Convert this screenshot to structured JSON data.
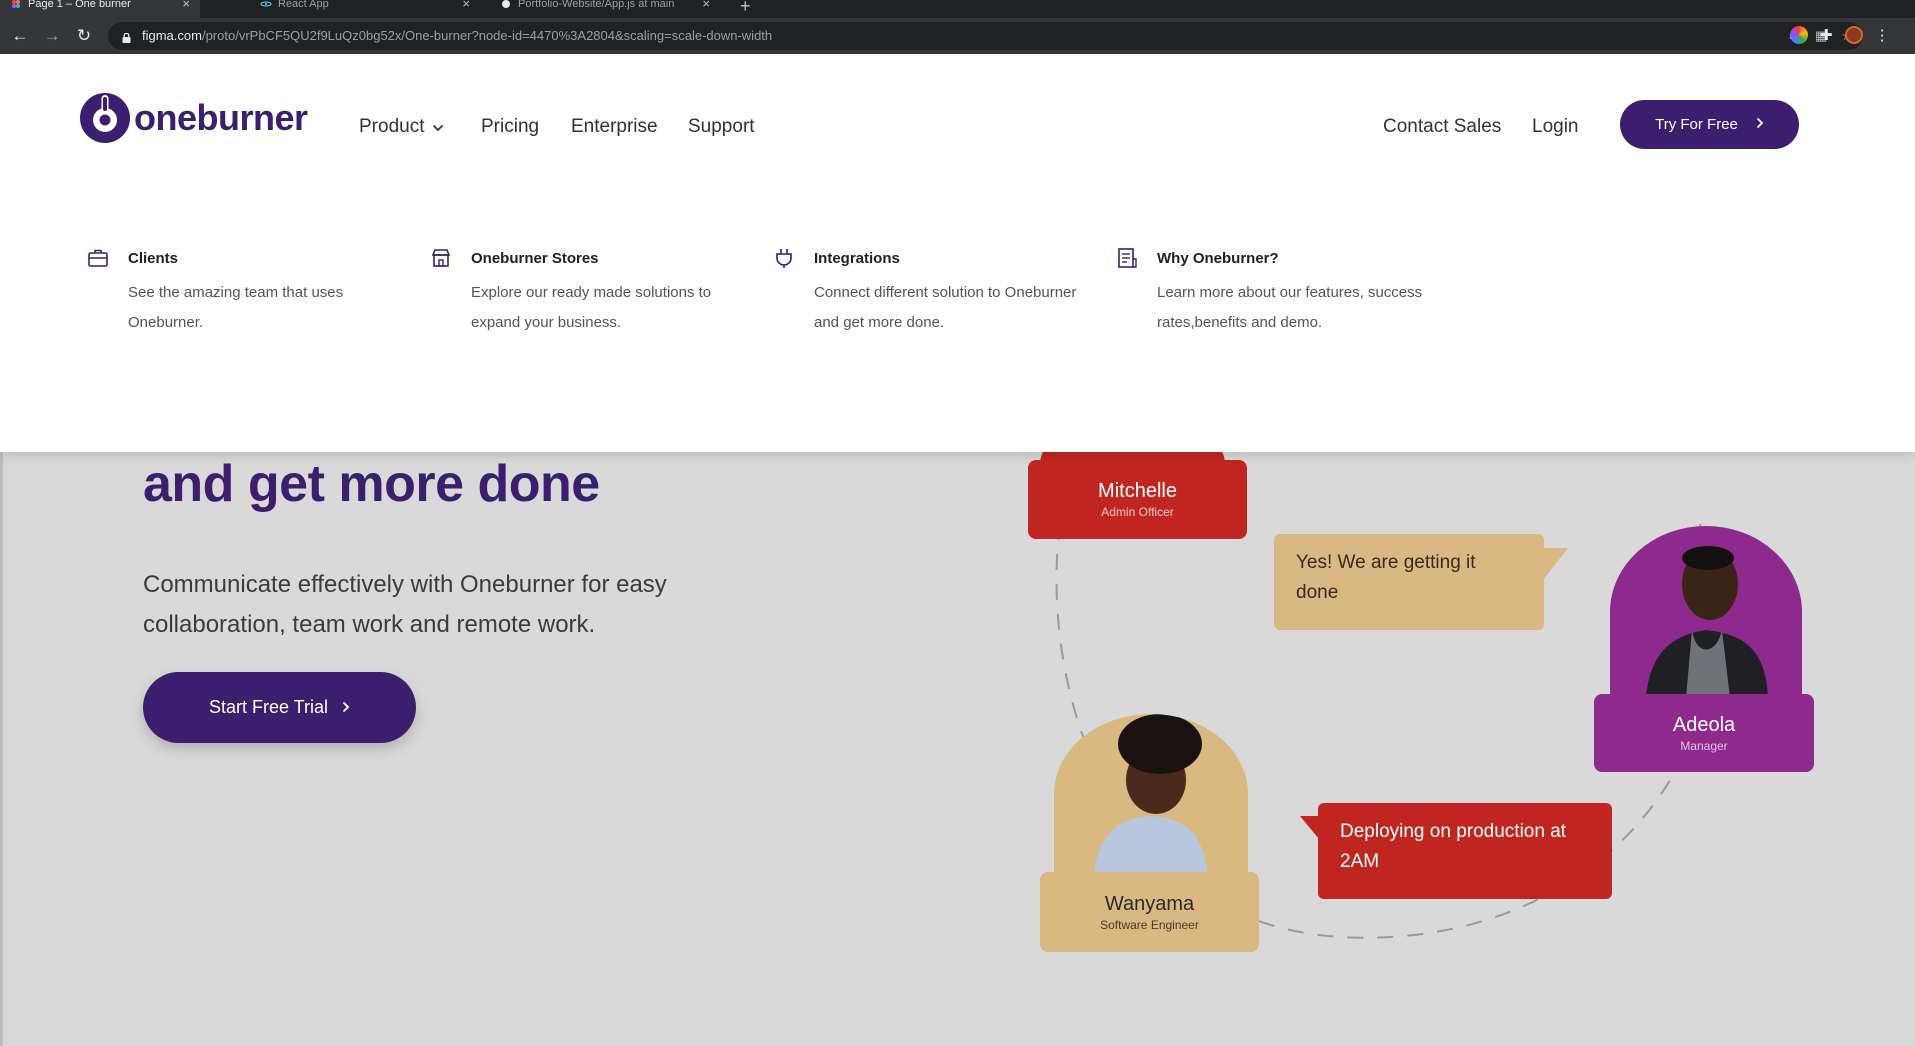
{
  "browser": {
    "tabs": [
      {
        "title": "Page 1 – One burner",
        "icon": "figma-icon",
        "active": true
      },
      {
        "title": "React App",
        "icon": "react-icon",
        "active": false
      },
      {
        "title": "Portfolio-Website/App.js at main",
        "icon": "github-icon",
        "active": false
      }
    ],
    "url_host": "figma.com",
    "url_path": "/proto/vrPbCF5QU2f9LuQz0bg52x/One-burner?node-id=4470%3A2804&scaling=scale-down-width"
  },
  "header": {
    "logo_text": "oneburner",
    "nav": {
      "product": "Product",
      "pricing": "Pricing",
      "enterprise": "Enterprise",
      "support": "Support"
    },
    "contact_sales": "Contact Sales",
    "login": "Login",
    "try_free": "Try For Free"
  },
  "product_menu": {
    "items": [
      {
        "icon": "briefcase-icon",
        "title": "Clients",
        "description": "See the amazing team that uses Oneburner."
      },
      {
        "icon": "store-icon",
        "title": "Oneburner Stores",
        "description": "Explore our ready made solutions to expand your business."
      },
      {
        "icon": "plug-icon",
        "title": "Integrations",
        "description": "Connect different solution to Oneburner and get more done."
      },
      {
        "icon": "document-icon",
        "title": "Why Oneburner?",
        "description": "Learn more about our features, success rates,benefits and demo."
      }
    ]
  },
  "hero": {
    "title_line2": "and get more done",
    "subtitle": "Communicate effectively with Oneburner for easy collaboration, team work and remote work.",
    "cta": "Start Free Trial"
  },
  "illustration": {
    "people": [
      {
        "name": "Mitchelle",
        "role": "Admin Officer"
      },
      {
        "name": "Adeola",
        "role": "Manager"
      },
      {
        "name": "Wanyama",
        "role": "Software Engineer"
      }
    ],
    "bubbles": [
      "Yes! We are getting it done",
      "Deploying on production at 2AM"
    ]
  },
  "colors": {
    "brand_purple": "#3b1f6e",
    "red": "#c0261f",
    "tan": "#d9b882",
    "magenta": "#8e2a8e"
  }
}
